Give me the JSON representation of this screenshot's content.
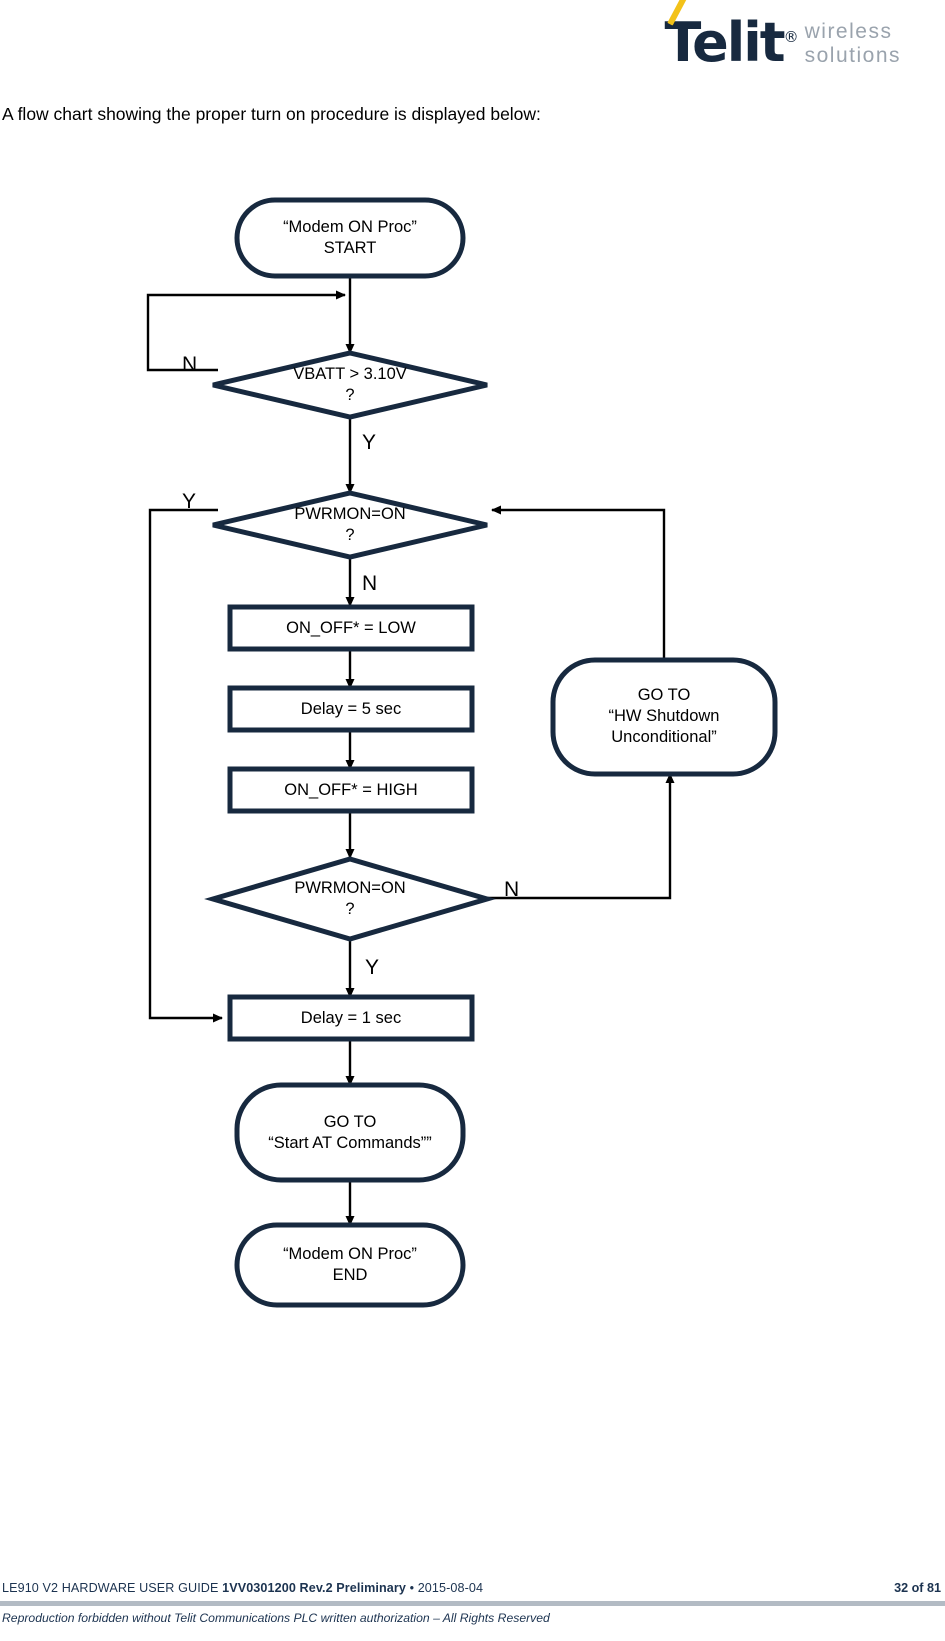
{
  "header": {
    "logo_wordmark": "Telit",
    "logo_registered": "®",
    "logo_tagline_line1": "wireless",
    "logo_tagline_line2": "solutions",
    "logo_navy": "#17293f",
    "logo_accent": "#f3c219",
    "logo_tagline_color": "#9aa3ad"
  },
  "body": {
    "intro": "A flow chart showing the proper turn on procedure is displayed below:"
  },
  "flowchart": {
    "line_color": "#17293f",
    "arrow_color": "#000000",
    "nodes": {
      "start": {
        "shape": "terminator",
        "text": "“Modem ON Proc”\nSTART"
      },
      "vbatt_check": {
        "shape": "decision",
        "text": "VBATT > 3.10V\n?"
      },
      "pwrmon_check_1": {
        "shape": "decision",
        "text": "PWRMON=ON\n?"
      },
      "on_off_low": {
        "shape": "process",
        "text": "ON_OFF* = LOW"
      },
      "delay_5": {
        "shape": "process",
        "text": "Delay = 5 sec"
      },
      "on_off_high": {
        "shape": "process",
        "text": "ON_OFF* = HIGH"
      },
      "pwrmon_check_2": {
        "shape": "decision",
        "text": "PWRMON=ON\n?"
      },
      "hw_shutdown": {
        "shape": "terminator",
        "text": "GO TO\n“HW Shutdown\nUnconditional”"
      },
      "delay_1": {
        "shape": "process",
        "text": "Delay = 1 sec"
      },
      "goto_at": {
        "shape": "terminator",
        "text": "GO TO\n“Start AT Commands””"
      },
      "end": {
        "shape": "terminator",
        "text": "“Modem ON Proc”\nEND"
      }
    },
    "edge_labels": {
      "vbatt_no": "N",
      "vbatt_yes": "Y",
      "pwrmon1_yes": "Y",
      "pwrmon1_no": "N",
      "pwrmon2_no": "N",
      "pwrmon2_yes": "Y"
    }
  },
  "footer": {
    "doc_title": "LE910 V2 HARDWARE USER GUIDE ",
    "doc_code": "1VV0301200 Rev.2 Preliminary",
    "doc_date": " • 2015-08-04",
    "page_number": "32 of 81",
    "copyright": "Reproduction forbidden without Telit Communications PLC written authorization – All Rights Reserved"
  }
}
